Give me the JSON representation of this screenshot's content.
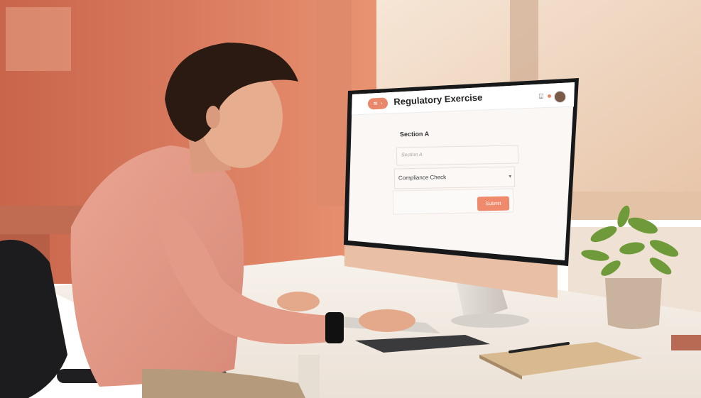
{
  "app": {
    "title": "Regulatory Exercise"
  },
  "form": {
    "section_heading": "Section A",
    "section_input_placeholder": "Section A",
    "select_value": "Compliance Check",
    "submit_label": "Submit"
  },
  "colors": {
    "wall": "#d9785c",
    "accent": "#e8876a",
    "screen_bg": "#fbf7f5",
    "desk": "#f3efe9"
  },
  "icons": {
    "menu": "menu-icon",
    "notification": "bell-icon",
    "user": "avatar"
  }
}
